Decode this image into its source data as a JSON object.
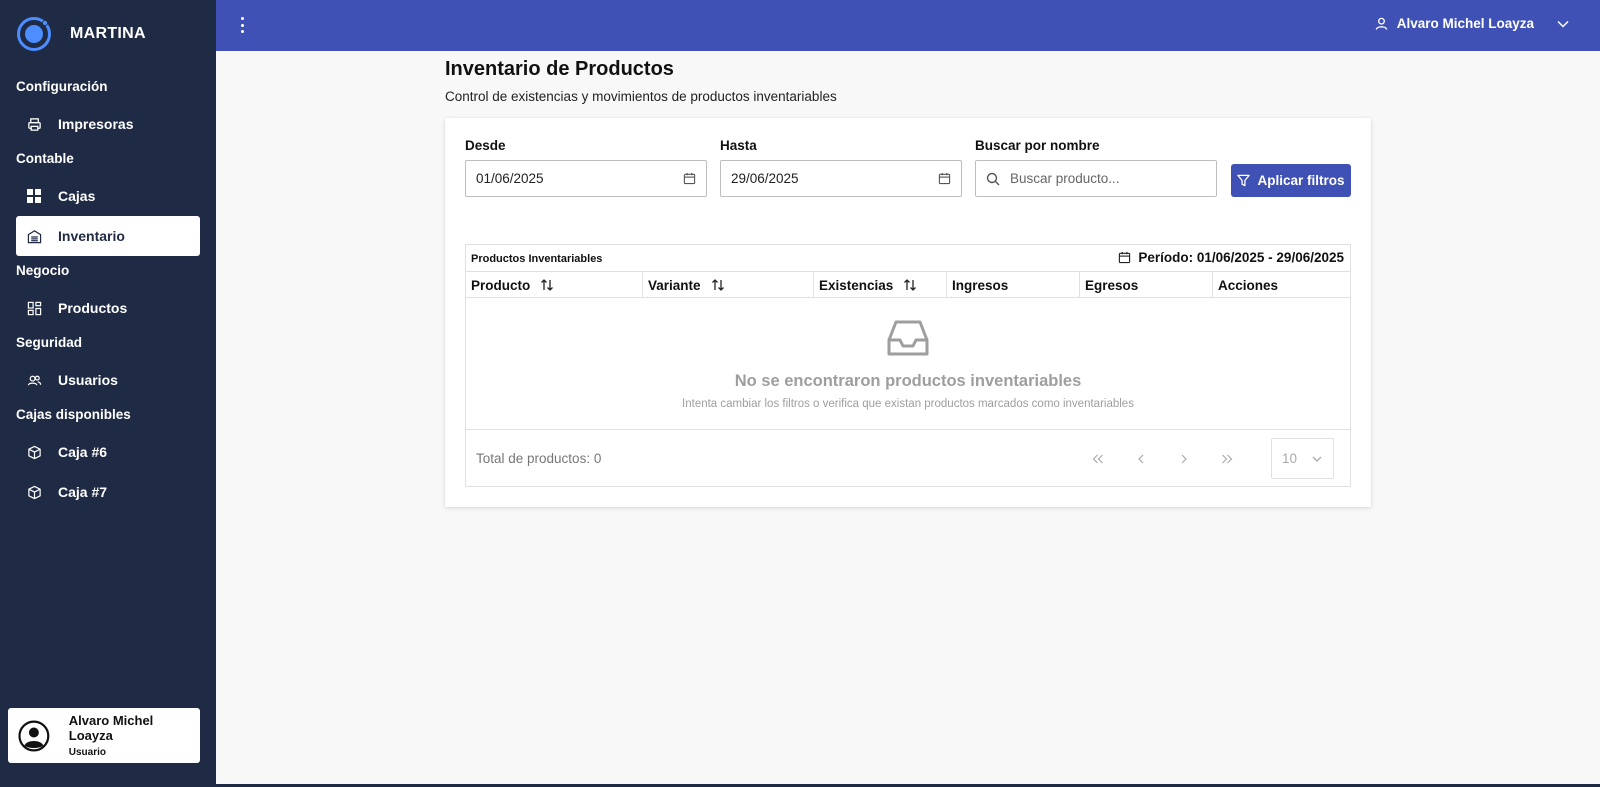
{
  "brand": {
    "name": "MARTINA"
  },
  "sidebar": {
    "sections": [
      {
        "label": "Configuración",
        "items": [
          {
            "label": "Impresoras",
            "icon": "printer-icon"
          }
        ]
      },
      {
        "label": "Contable",
        "items": [
          {
            "label": "Cajas",
            "icon": "grid-icon"
          },
          {
            "label": "Inventario",
            "icon": "warehouse-icon",
            "active": true
          }
        ]
      },
      {
        "label": "Negocio",
        "items": [
          {
            "label": "Productos",
            "icon": "dashboard-icon"
          }
        ]
      },
      {
        "label": "Seguridad",
        "items": [
          {
            "label": "Usuarios",
            "icon": "users-icon"
          }
        ]
      },
      {
        "label": "Cajas disponibles",
        "items": [
          {
            "label": "Caja #6",
            "icon": "box-icon"
          },
          {
            "label": "Caja #7",
            "icon": "box-icon"
          }
        ]
      }
    ],
    "user": {
      "name": "Alvaro Michel Loayza",
      "role": "Usuario"
    }
  },
  "topbar": {
    "user_name": "Alvaro Michel Loayza"
  },
  "page": {
    "title": "Inventario de Productos",
    "subtitle": "Control de existencias y movimientos de productos inventariables"
  },
  "filters": {
    "from_label": "Desde",
    "from_value": "01/06/2025",
    "to_label": "Hasta",
    "to_value": "29/06/2025",
    "search_label": "Buscar por nombre",
    "search_placeholder": "Buscar producto...",
    "apply_label": "Aplicar filtros"
  },
  "table": {
    "caption": "Productos Inventariables",
    "period": "Período: 01/06/2025 - 29/06/2025",
    "columns": [
      {
        "label": "Producto",
        "sortable": true
      },
      {
        "label": "Variante",
        "sortable": true
      },
      {
        "label": "Existencias",
        "sortable": true
      },
      {
        "label": "Ingresos",
        "sortable": false
      },
      {
        "label": "Egresos",
        "sortable": false
      },
      {
        "label": "Acciones",
        "sortable": false
      }
    ],
    "empty_title": "No se encontraron productos inventariables",
    "empty_description": "Intenta cambiar los filtros o verifica que existan productos marcados como inventariables",
    "total_text": "Total de productos: 0",
    "rows_per_page": "10"
  },
  "colors": {
    "sidebar_bg": "#1f2a44",
    "topbar_bg": "#3f51b5",
    "accent": "#3f51b5",
    "empty_text": "#9e9e9e"
  }
}
